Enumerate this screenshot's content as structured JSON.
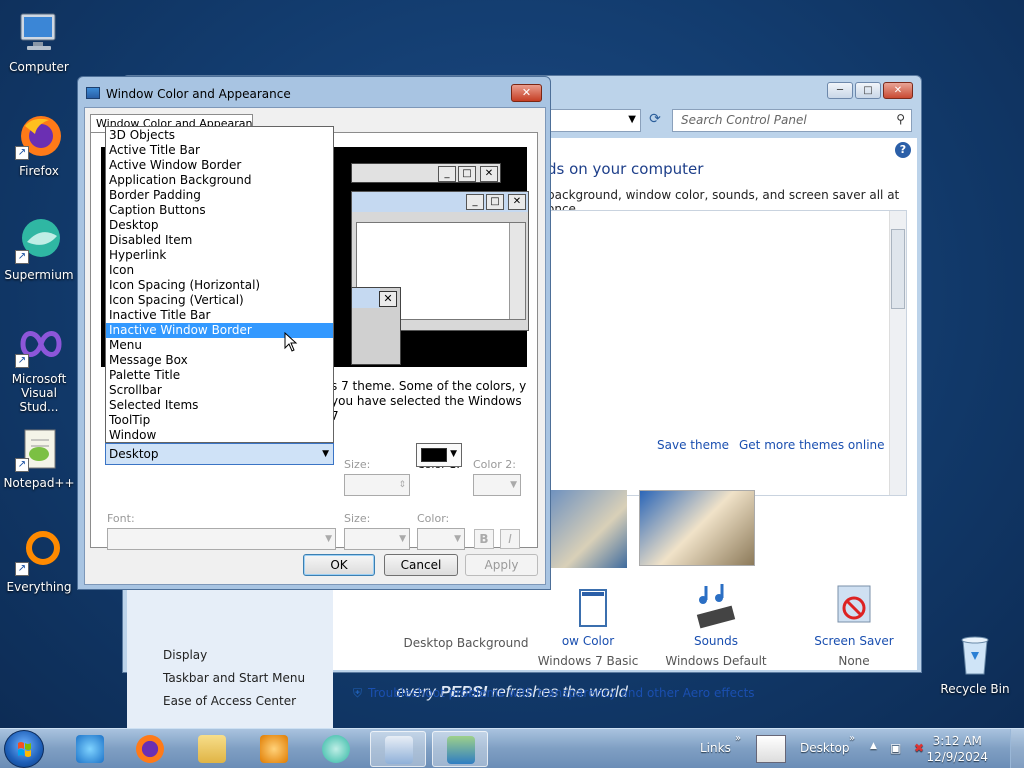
{
  "desktop": {
    "icons": [
      {
        "label": "Computer"
      },
      {
        "label": "Firefox"
      },
      {
        "label": "Supermium"
      },
      {
        "label": "Microsoft Visual Stud..."
      },
      {
        "label": "Notepad++"
      },
      {
        "label": "Everything"
      },
      {
        "label": "Recycle Bin"
      }
    ],
    "wallpaper_text": {
      "pre": "every ",
      "brand": "PEPSI",
      "post": " refreshes the world"
    }
  },
  "control_panel": {
    "search_placeholder": "Search Control Panel",
    "heading": "ds on your computer",
    "subheading": "background, window color, sounds, and screen saver all at once.",
    "save_theme": "Save theme",
    "more_themes": "Get more themes online",
    "left_links": [
      "Display",
      "Taskbar and Start Menu",
      "Ease of Access Center"
    ],
    "bottom_items": [
      {
        "title": "",
        "subtitle": "Desktop Background"
      },
      {
        "title": "ow Color",
        "subtitle": "Windows 7 Basic"
      },
      {
        "title": "Sounds",
        "subtitle": "Windows Default"
      },
      {
        "title": "Screen Saver",
        "subtitle": "None"
      }
    ],
    "troubleshoot": "Troubleshoot problems with transparency and other Aero effects"
  },
  "dialog": {
    "title": "Window Color and Appearance",
    "tab": "Window Color and Appearance",
    "description": "s 7 theme.  Some of the colors, y you have selected the Windows 7",
    "labels": {
      "size": "Size:",
      "color1": "Color 1:",
      "color2": "Color 2:",
      "font": "Font:",
      "font_size": "Size:",
      "font_color": "Color:",
      "bold": "B",
      "italic": "I"
    },
    "item_selected": "Desktop",
    "color1_value": "#000000",
    "buttons": {
      "ok": "OK",
      "cancel": "Cancel",
      "apply": "Apply"
    },
    "item_list": [
      "3D Objects",
      "Active Title Bar",
      "Active Window Border",
      "Application Background",
      "Border Padding",
      "Caption Buttons",
      "Desktop",
      "Disabled Item",
      "Hyperlink",
      "Icon",
      "Icon Spacing (Horizontal)",
      "Icon Spacing (Vertical)",
      "Inactive Title Bar",
      "Inactive Window Border",
      "Menu",
      "Message Box",
      "Palette Title",
      "Scrollbar",
      "Selected Items",
      "ToolTip",
      "Window"
    ],
    "highlighted_item": "Inactive Window Border"
  },
  "taskbar": {
    "links": "Links",
    "desktop": "Desktop",
    "time": "3:12 AM",
    "date": "12/9/2024"
  },
  "colors": {
    "selection": "#3399ff",
    "link": "#1a4fb0"
  }
}
